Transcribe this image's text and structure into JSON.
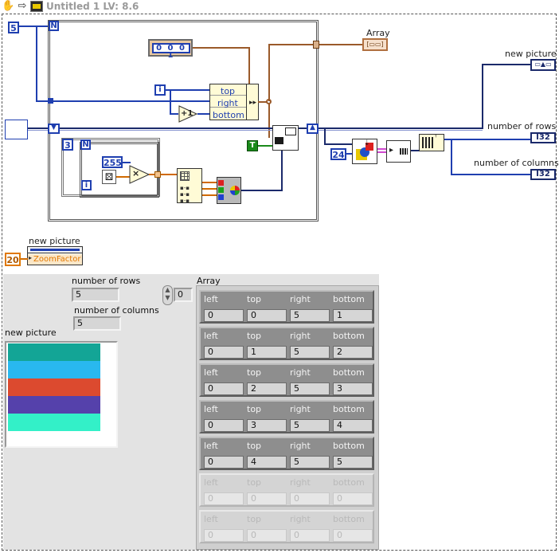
{
  "window": {
    "title": "Untitled 1 LV: 8.6"
  },
  "toolbar": {
    "hand_icon": "hand-icon",
    "arrow_icon": "run-arrow-icon",
    "vi_icon": "vi-icon"
  },
  "diagram": {
    "rows_const": "5",
    "loop_n": "N",
    "inner_n": "N",
    "inner_count_const": "3",
    "iter_i": "i",
    "inner_i": "i",
    "bool_const": "0 0 0 1",
    "bundle_top": "top",
    "bundle_right": "right",
    "bundle_bottom": "bottom",
    "color_const": "255",
    "increment_label": "+1",
    "multiply_label": "×",
    "true_const": "T",
    "zoom_const": "20",
    "size_const": "24",
    "array_label": "Array",
    "new_picture_label": "new picture",
    "number_of_rows_label": "number of rows",
    "number_of_columns_label": "number of columns",
    "rows_term": "I32",
    "cols_term": "I32",
    "zoom_property": "ZoomFactor",
    "prop_node_label": "new picture"
  },
  "panel": {
    "number_of_rows_label": "number of rows",
    "number_of_rows_value": "5",
    "number_of_columns_label": "number of columns",
    "number_of_columns_value": "5",
    "new_picture_label": "new picture",
    "array_label": "Array",
    "array_index": "0",
    "headers": [
      "left",
      "top",
      "right",
      "bottom"
    ],
    "rows": [
      {
        "left": "0",
        "top": "0",
        "right": "5",
        "bottom": "1",
        "active": true
      },
      {
        "left": "0",
        "top": "1",
        "right": "5",
        "bottom": "2",
        "active": true
      },
      {
        "left": "0",
        "top": "2",
        "right": "5",
        "bottom": "3",
        "active": true
      },
      {
        "left": "0",
        "top": "3",
        "right": "5",
        "bottom": "4",
        "active": true
      },
      {
        "left": "0",
        "top": "4",
        "right": "5",
        "bottom": "5",
        "active": true
      },
      {
        "left": "0",
        "top": "0",
        "right": "0",
        "bottom": "0",
        "active": false
      },
      {
        "left": "0",
        "top": "0",
        "right": "0",
        "bottom": "0",
        "active": false
      }
    ],
    "picture_stripes": [
      "#13a596",
      "#29b8ef",
      "#dc4a2f",
      "#5541ab",
      "#33f0c8"
    ]
  }
}
